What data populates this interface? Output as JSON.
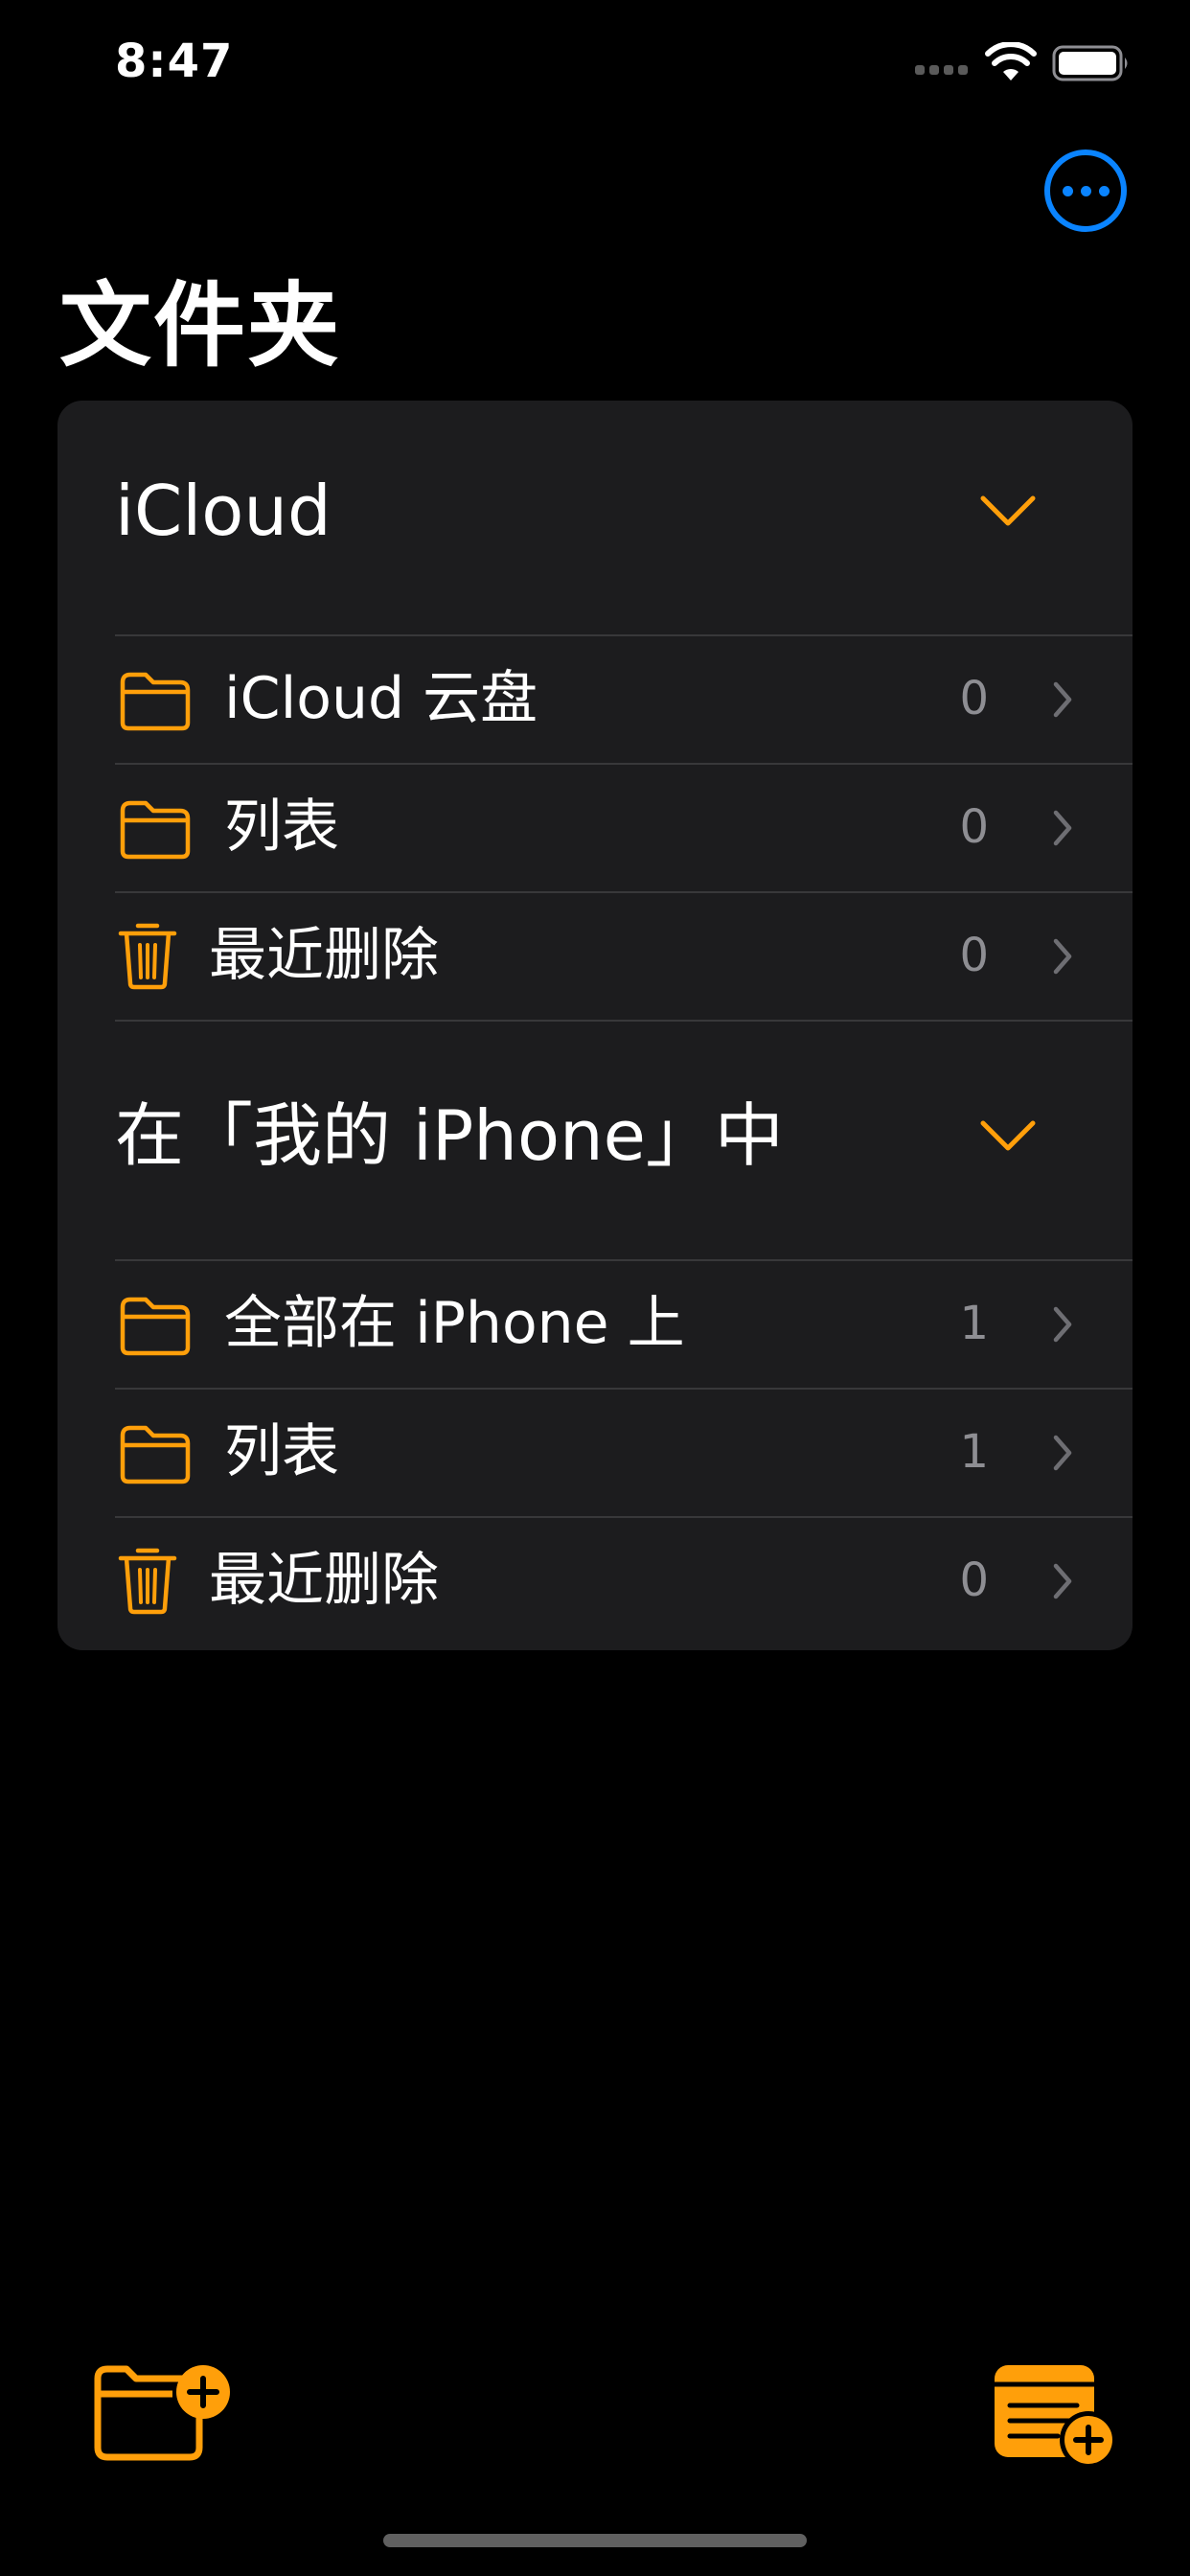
{
  "status_bar": {
    "time": "8:47"
  },
  "header": {
    "title": "文件夹"
  },
  "sections": [
    {
      "title": "iCloud",
      "rows": [
        {
          "icon": "folder-icon",
          "label": "iCloud 云盘",
          "count": "0"
        },
        {
          "icon": "folder-icon",
          "label": "列表",
          "count": "0"
        },
        {
          "icon": "trash-icon",
          "label": "最近删除",
          "count": "0"
        }
      ]
    },
    {
      "title": "在「我的 iPhone」中",
      "rows": [
        {
          "icon": "folder-icon",
          "label": "全部在 iPhone 上",
          "count": "1"
        },
        {
          "icon": "folder-icon",
          "label": "列表",
          "count": "1"
        },
        {
          "icon": "trash-icon",
          "label": "最近删除",
          "count": "0"
        }
      ]
    }
  ],
  "toolbar": {
    "left_icon": "new-folder-icon",
    "right_icon": "new-note-icon"
  },
  "colors": {
    "accent": "#ff9f0a",
    "link": "#0a84ff",
    "background": "#000000",
    "card": "#1c1c1e",
    "secondary_text": "#8e8e93",
    "separator": "#38383a"
  }
}
